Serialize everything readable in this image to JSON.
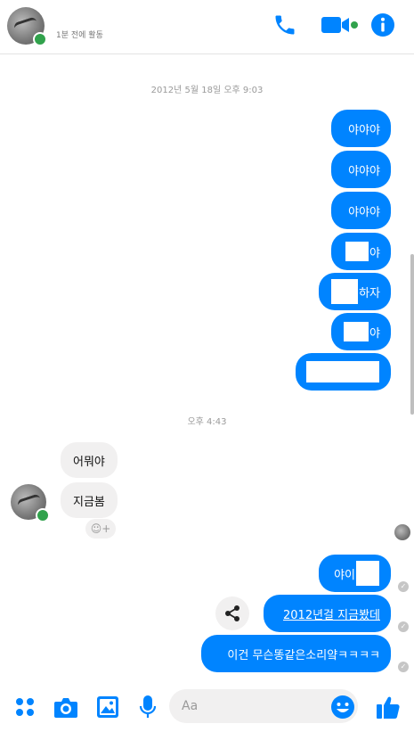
{
  "header": {
    "status": "1분 전에 활동"
  },
  "conversation": {
    "timestamp_1": "2012년 5월 18일 오후 9:03",
    "outgoing_1": [
      {
        "text": "야야야"
      },
      {
        "text": "야야야"
      },
      {
        "text": "야야야"
      },
      {
        "text": "야"
      },
      {
        "text": "하자"
      },
      {
        "text": "야"
      },
      {
        "text": ""
      }
    ],
    "timestamp_2": "오후 4:43",
    "incoming": [
      {
        "text": "어뭐야"
      },
      {
        "text": "지금봄"
      }
    ],
    "outgoing_2": [
      {
        "text": "야이"
      },
      {
        "text": "2012년걸 지금봤데"
      },
      {
        "text": "이건 무슨똥같은소리얔ㅋㅋㅋㅋ"
      }
    ]
  },
  "composer": {
    "placeholder": "Aa"
  },
  "colors": {
    "accent": "#0084ff",
    "online": "#31a24c",
    "incoming_bubble": "#f1f0f0"
  },
  "icons": [
    "phone-icon",
    "video-icon",
    "info-icon",
    "apps-icon",
    "camera-icon",
    "gallery-icon",
    "mic-icon",
    "emoji-icon",
    "like-icon",
    "share-icon"
  ]
}
